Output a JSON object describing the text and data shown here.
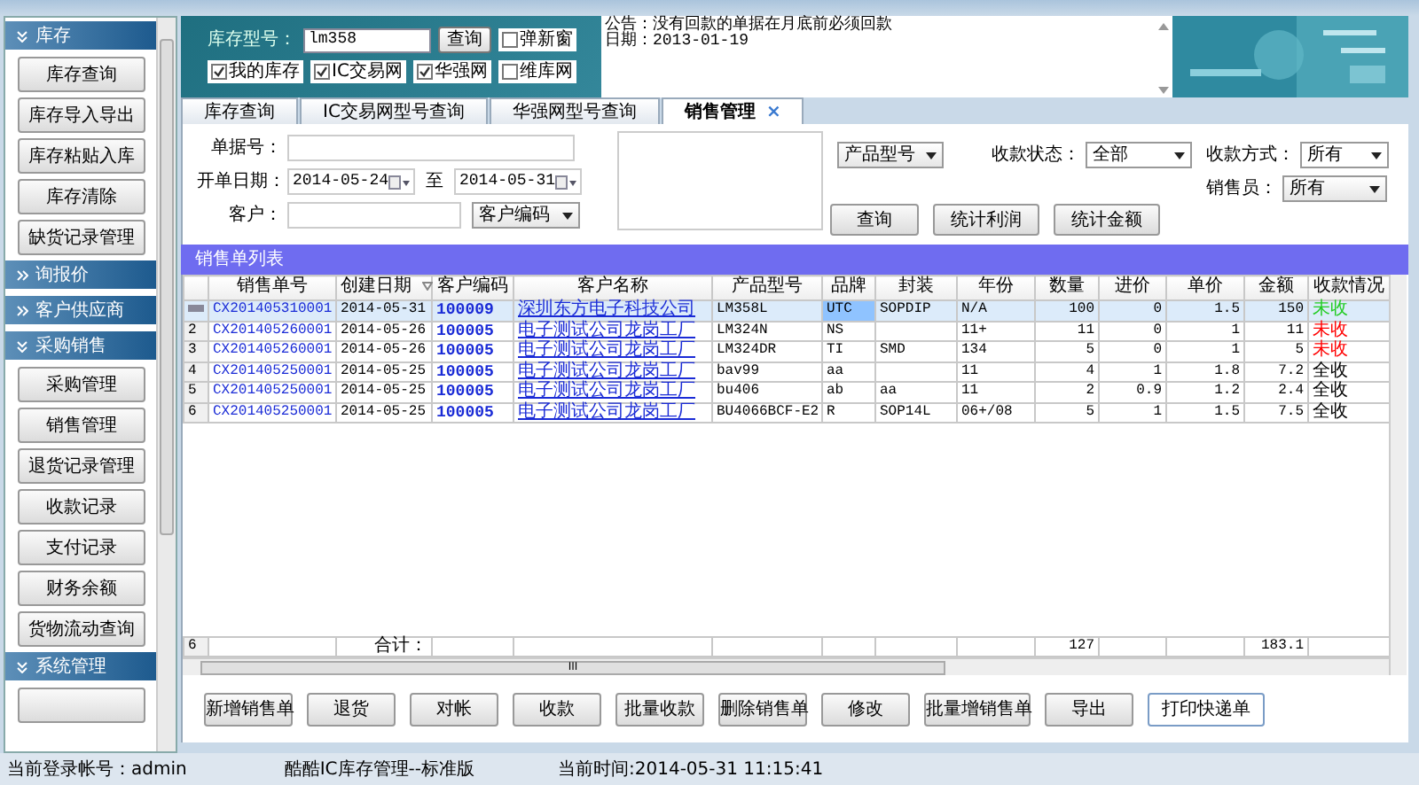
{
  "sidebar": {
    "groups": [
      {
        "label": "库存",
        "expanded": true,
        "items": [
          "库存查询",
          "库存导入导出",
          "库存粘贴入库",
          "库存清除",
          "缺货记录管理"
        ]
      },
      {
        "label": "询报价",
        "expanded": false
      },
      {
        "label": "客户供应商",
        "expanded": false
      },
      {
        "label": "采购销售",
        "expanded": true,
        "items": [
          "采购管理",
          "销售管理",
          "退货记录管理",
          "收款记录",
          "支付记录",
          "财务余额",
          "货物流动查询"
        ]
      },
      {
        "label": "系统管理",
        "expanded": true,
        "more_below": true
      }
    ]
  },
  "header": {
    "stock_label": "库存型号：",
    "stock_value": "lm358",
    "search_button": "查询",
    "options": [
      {
        "label": "弹新窗",
        "checked": false
      }
    ],
    "sources": [
      {
        "label": "我的库存",
        "checked": true
      },
      {
        "label": "IC交易网",
        "checked": true
      },
      {
        "label": "华强网",
        "checked": true
      },
      {
        "label": "维库网",
        "checked": false
      }
    ],
    "notice": [
      "公告：没有回款的单据在月底前必须回款",
      "日期：2013-01-19"
    ]
  },
  "tabs": [
    {
      "label": "库存查询",
      "selected": false
    },
    {
      "label": "IC交易网型号查询",
      "selected": false
    },
    {
      "label": "华强网型号查询",
      "selected": false
    },
    {
      "label": "销售管理",
      "selected": true,
      "close": "×"
    }
  ],
  "form": {
    "doc_label": "单据号：",
    "date_label": "开单日期：",
    "date_from": "2014-05-24",
    "date_sep": "至",
    "date_to": "2014-05-31",
    "customer_label": "客户：",
    "customer_mode": "客户编码",
    "product_mode": "产品型号",
    "status_label": "收款状态：",
    "status_value": "全部",
    "method_label": "收款方式：",
    "method_value": "所有",
    "seller_label": "销售员：",
    "seller_value": "所有",
    "buttons": [
      "查询",
      "统计利润",
      "统计金额"
    ]
  },
  "grid": {
    "title": "销售单列表",
    "columns": [
      "销售单号",
      "创建日期",
      "客户编码",
      "客户名称",
      "产品型号",
      "品牌",
      "封装",
      "年份",
      "数量",
      "进价",
      "单价",
      "金额",
      "收款情况"
    ],
    "rows": [
      {
        "row_header": "",
        "selected": true,
        "cells": [
          "CX201405310001",
          "2014-05-31",
          "100009",
          "深圳东方电子科技公司",
          "LM358L",
          "UTC",
          "SOPDIP",
          "N/A",
          "100",
          "0",
          "1.5",
          "150",
          "未收"
        ],
        "color": "#22cc22"
      },
      {
        "row_header": "2",
        "selected": false,
        "cells": [
          "CX201405260001",
          "2014-05-26",
          "100005",
          "电子测试公司龙岗工厂",
          "LM324N",
          "NS",
          "",
          "11+",
          "11",
          "0",
          "1",
          "11",
          "未收"
        ],
        "color": "#ff0000"
      },
      {
        "row_header": "3",
        "selected": false,
        "cells": [
          "CX201405260001",
          "2014-05-26",
          "100005",
          "电子测试公司龙岗工厂",
          "LM324DR",
          "TI",
          "SMD",
          "134",
          "5",
          "0",
          "1",
          "5",
          "未收"
        ],
        "color": "#ff0000"
      },
      {
        "row_header": "4",
        "selected": false,
        "cells": [
          "CX201405250001",
          "2014-05-25",
          "100005",
          "电子测试公司龙岗工厂",
          "bav99",
          "aa",
          "",
          "11",
          "4",
          "1",
          "1.8",
          "7.2",
          "全收"
        ],
        "color": "#000000"
      },
      {
        "row_header": "5",
        "selected": false,
        "cells": [
          "CX201405250001",
          "2014-05-25",
          "100005",
          "电子测试公司龙岗工厂",
          "bu406",
          "ab",
          "aa",
          "11",
          "2",
          "0.9",
          "1.2",
          "2.4",
          "全收"
        ],
        "color": "#000000"
      },
      {
        "row_header": "6",
        "selected": false,
        "cells": [
          "CX201405250001",
          "2014-05-25",
          "100005",
          "电子测试公司龙岗工厂",
          "BU4066BCF-E2",
          "R",
          "SOP14L",
          "06+/08",
          "5",
          "1",
          "1.5",
          "7.5",
          "全收"
        ],
        "color": "#000000"
      }
    ],
    "total": {
      "row_header": "6",
      "label": "合计：",
      "quantity": "127",
      "amount": "183.1"
    },
    "scroll_grip": "III"
  },
  "actions": [
    {
      "label": "新增销售单",
      "kind": "normal"
    },
    {
      "label": "退货",
      "kind": "normal"
    },
    {
      "label": "对帐",
      "kind": "normal"
    },
    {
      "label": "收款",
      "kind": "normal"
    },
    {
      "label": "批量收款",
      "kind": "normal"
    },
    {
      "label": "删除销售单",
      "kind": "normal"
    },
    {
      "label": "修改",
      "kind": "normal"
    },
    {
      "label": "批量增销售单",
      "kind": "normal"
    },
    {
      "label": "导出",
      "kind": "normal"
    },
    {
      "label": "打印快递单",
      "kind": "flat"
    }
  ],
  "status_bar": [
    "当前登录帐号：admin",
    "酷酷IC库存管理--标准版",
    "当前时间:2014-05-31 11:15:41"
  ]
}
